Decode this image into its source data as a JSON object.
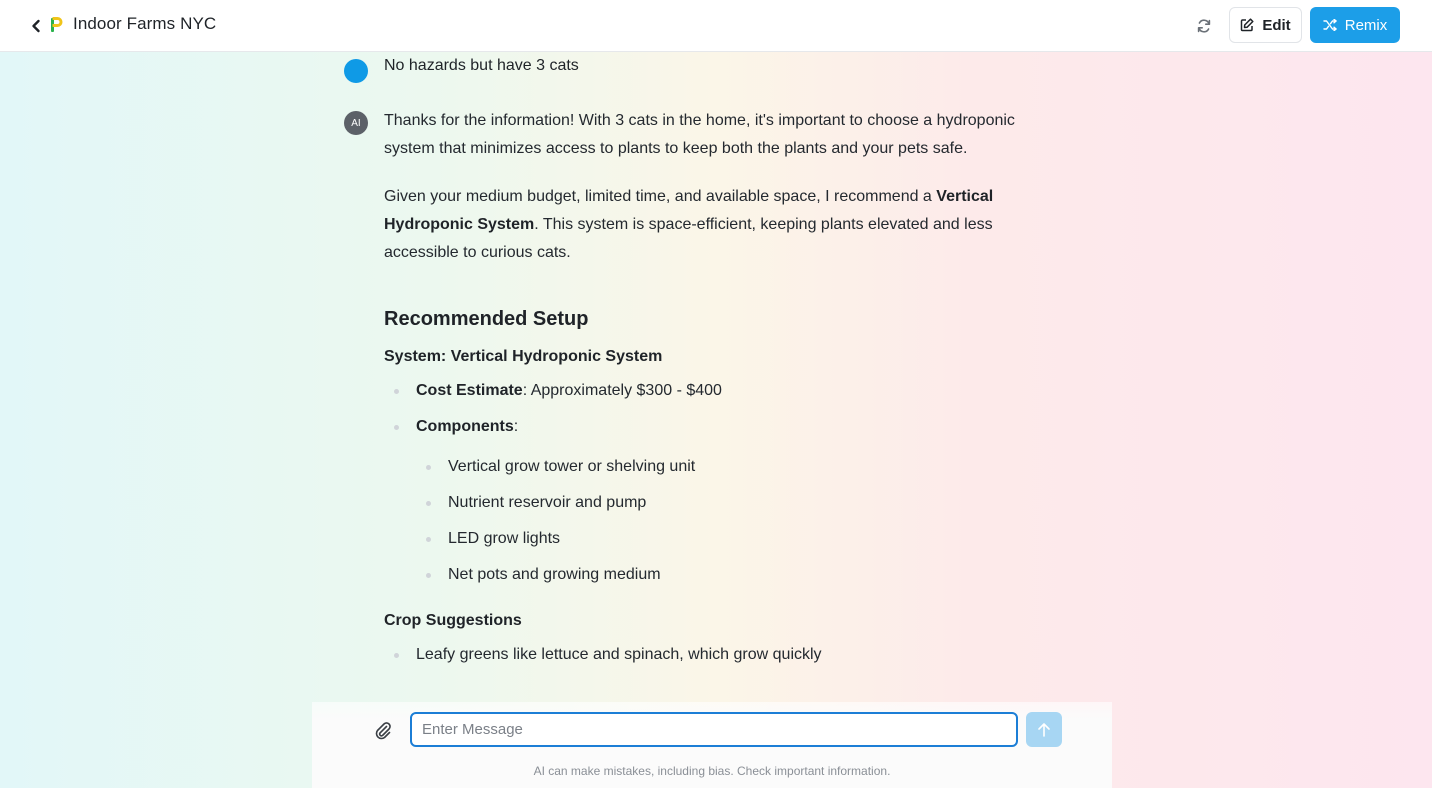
{
  "header": {
    "title": "Indoor Farms NYC",
    "edit_label": "Edit",
    "remix_label": "Remix"
  },
  "colors": {
    "accent": "#1c9ee8",
    "user_avatar": "#0f9ae6",
    "ai_avatar": "#5c6168"
  },
  "icons": {
    "back": "chevron-left-icon",
    "logo": "p-logo-icon",
    "refresh": "refresh-icon",
    "edit": "pencil-icon",
    "remix": "shuffle-icon",
    "attach": "paperclip-icon",
    "send": "arrow-up-icon"
  },
  "chat": {
    "user_message": "No hazards but have 3 cats",
    "ai_avatar_label": "AI",
    "ai_message": {
      "para1": "Thanks for the information! With 3 cats in the home, it's important to choose a hydroponic system that minimizes access to plants to keep both the plants and your pets safe.",
      "para2_before": "Given your medium budget, limited time, and available space, I recommend a ",
      "para2_bold": "Vertical Hydroponic System",
      "para2_after": ". This system is space-efficient, keeping plants elevated and less accessible to curious cats.",
      "heading": "Recommended Setup",
      "system_label": "System: Vertical Hydroponic System",
      "cost_label": "Cost Estimate",
      "cost_value": ": Approximately $300 - $400",
      "components_label": "Components",
      "components_colon": ":",
      "components": [
        "Vertical grow tower or shelving unit",
        "Nutrient reservoir and pump",
        "LED grow lights",
        "Net pots and growing medium"
      ],
      "crop_label": "Crop Suggestions",
      "crops": [
        "Leafy greens like lettuce and spinach, which grow quickly"
      ]
    }
  },
  "composer": {
    "placeholder": "Enter Message",
    "disclaimer": "AI can make mistakes, including bias. Check important information."
  }
}
